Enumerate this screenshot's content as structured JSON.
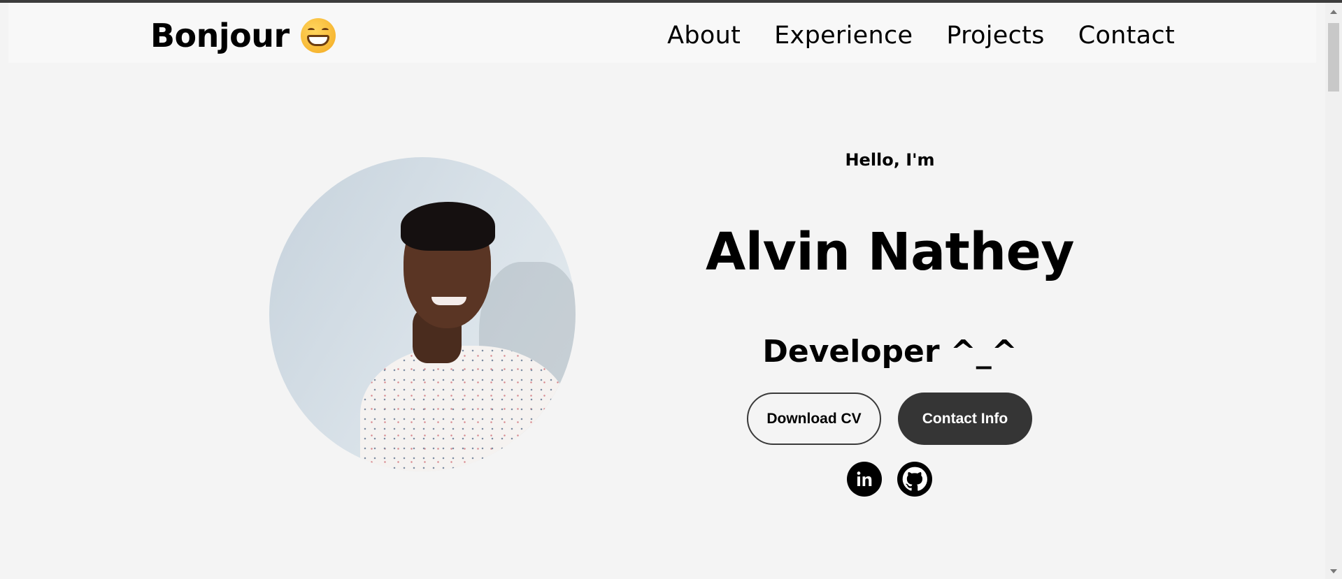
{
  "nav": {
    "logo_text": "Bonjour",
    "logo_emoji": "grinning-face-emoji",
    "links": [
      "About",
      "Experience",
      "Projects",
      "Contact"
    ]
  },
  "hero": {
    "greeting": "Hello, I'm",
    "name": "Alvin Nathey",
    "role": "Developer ^_^",
    "buttons": {
      "download_cv": "Download CV",
      "contact_info": "Contact Info"
    },
    "social_icons": [
      "linkedin-icon",
      "github-icon"
    ]
  },
  "colors": {
    "page_background": "#f4f4f4",
    "navbar_background": "#f8f8f8",
    "solid_button": "#353535",
    "text": "#000000"
  }
}
